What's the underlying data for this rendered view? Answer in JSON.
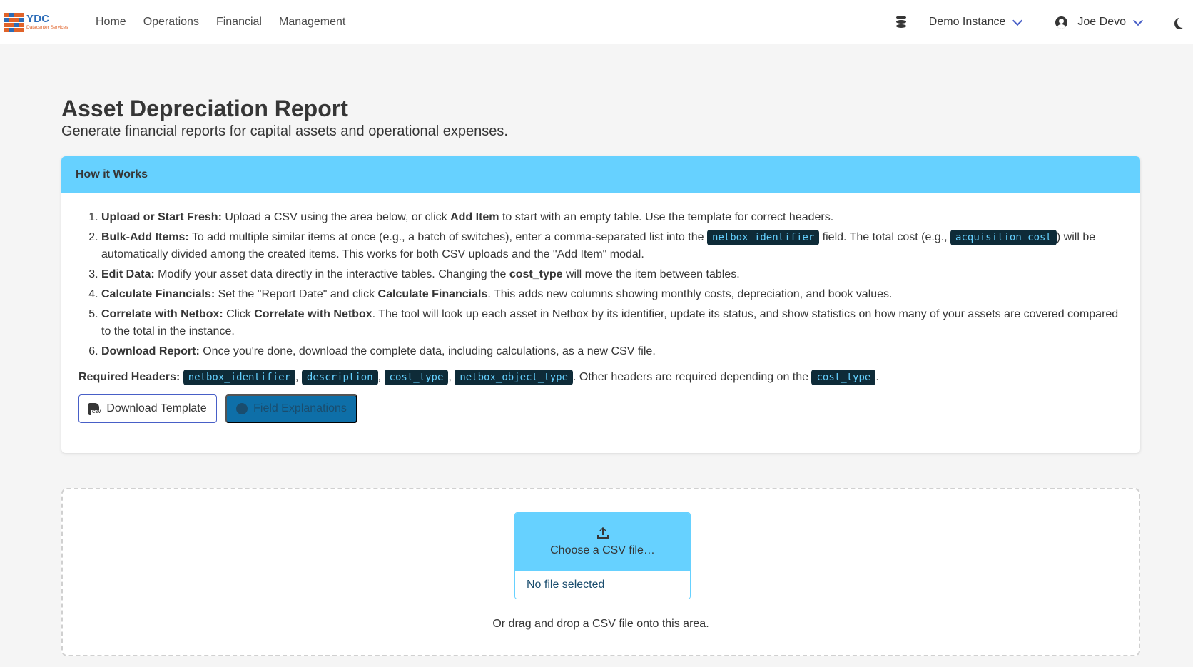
{
  "brand": {
    "name": "YDC",
    "tagline": "Datacenter Services"
  },
  "nav": {
    "links": [
      "Home",
      "Operations",
      "Financial",
      "Management"
    ],
    "instance": "Demo Instance",
    "user": "Joe Devo"
  },
  "page": {
    "title": "Asset Depreciation Report",
    "subtitle": "Generate financial reports for capital assets and operational expenses."
  },
  "how": {
    "header": "How it Works",
    "s1_title": "Upload or Start Fresh:",
    "s1_a": " Upload a CSV using the area below, or click ",
    "s1_b": "Add Item",
    "s1_c": " to start with an empty table. Use the template for correct headers.",
    "s2_title": "Bulk-Add Items:",
    "s2_a": " To add multiple similar items at once (e.g., a batch of switches), enter a comma-separated list into the ",
    "s2_code1": "netbox_identifier",
    "s2_b": " field. The total cost (e.g., ",
    "s2_code2": "acquisition_cost",
    "s2_c": ") will be automatically divided among the created items. This works for both CSV uploads and the \"Add Item\" modal.",
    "s3_title": "Edit Data:",
    "s3_a": " Modify your asset data directly in the interactive tables. Changing the ",
    "s3_b": "cost_type",
    "s3_c": " will move the item between tables.",
    "s4_title": "Calculate Financials:",
    "s4_a": " Set the \"Report Date\" and click ",
    "s4_b": "Calculate Financials",
    "s4_c": ". This adds new columns showing monthly costs, depreciation, and book values.",
    "s5_title": "Correlate with Netbox:",
    "s5_a": " Click ",
    "s5_b": "Correlate with Netbox",
    "s5_c": ". The tool will look up each asset in Netbox by its identifier, update its status, and show statistics on how many of your assets are covered compared to the total in the instance.",
    "s6_title": "Download Report:",
    "s6_a": " Once you're done, download the complete data, including calculations, as a new CSV file.",
    "req_label": "Required Headers:",
    "req_headers": [
      "netbox_identifier",
      "description",
      "cost_type",
      "netbox_object_type"
    ],
    "req_sep": ",",
    "req_other": ". Other headers are required depending on the ",
    "req_code": "cost_type",
    "req_end": ".",
    "btn_template": "Download Template",
    "btn_fields": "Field Explanations"
  },
  "upload": {
    "cta": "Choose a CSV file…",
    "no_file": "No file selected",
    "hint": "Or drag and drop a CSV file onto this area."
  },
  "colors": {
    "info": "#66d1ff",
    "link": "#485fc7",
    "code_bg": "#0e2b38"
  }
}
